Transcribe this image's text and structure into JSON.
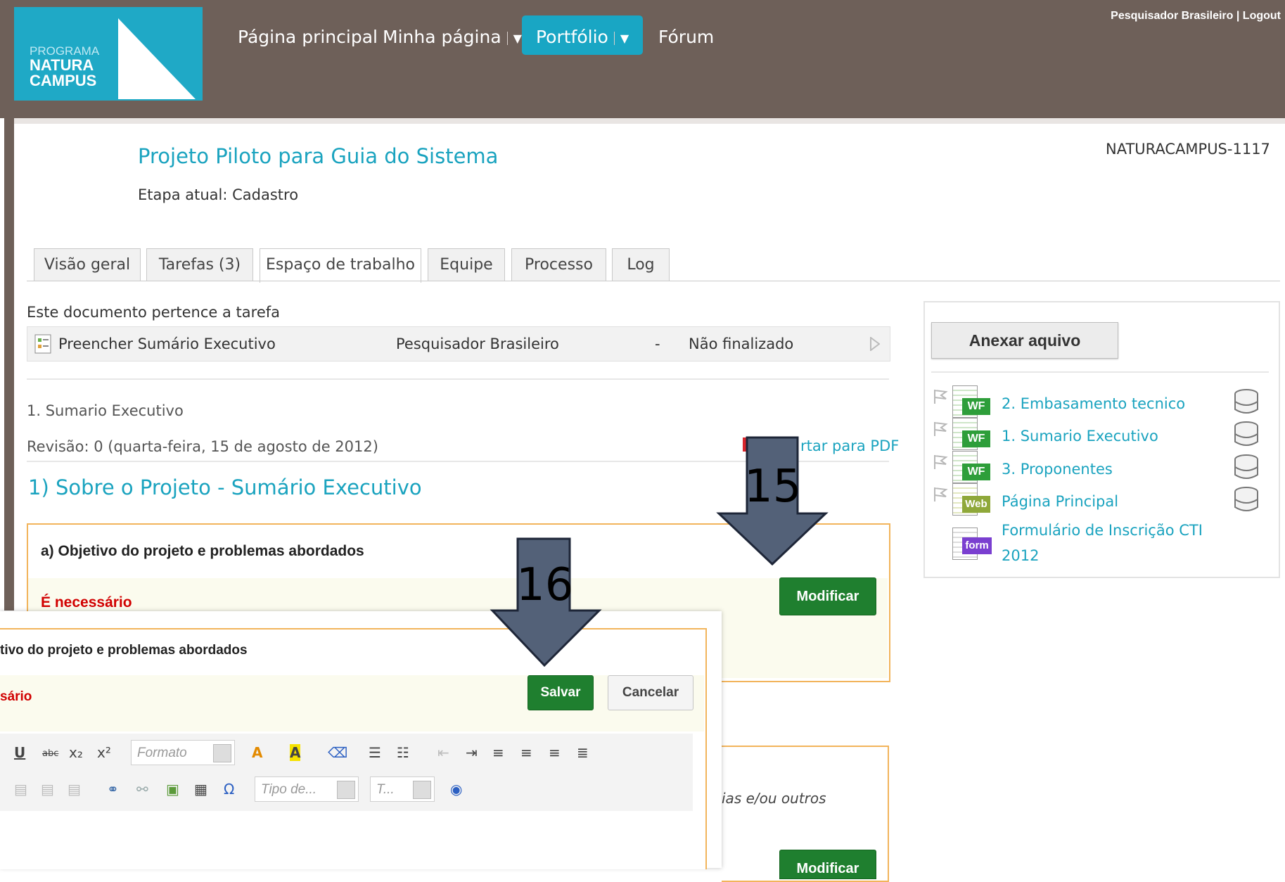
{
  "header": {
    "logo": {
      "line1": "PROGRAMA",
      "line2": "NATURA",
      "line3": "CAMPUS"
    },
    "nav": [
      {
        "label": "Página principal"
      },
      {
        "label": "Minha página"
      },
      {
        "label": "Portfólio"
      },
      {
        "label": "Fórum"
      }
    ],
    "user_links": "Pesquisador Brasileiro | Logout"
  },
  "project": {
    "title": "Projeto Piloto para Guia do Sistema",
    "stage": "Etapa atual: Cadastro",
    "id": "NATURACAMPUS-1117"
  },
  "tabs": [
    {
      "label": "Visão geral"
    },
    {
      "label": "Tarefas (3)"
    },
    {
      "label": "Espaço de trabalho",
      "active": true
    },
    {
      "label": "Equipe"
    },
    {
      "label": "Processo"
    },
    {
      "label": "Log"
    }
  ],
  "task": {
    "heading": "Este documento pertence a tarefa",
    "name": "Preencher Sumário Executivo",
    "owner": "Pesquisador Brasileiro",
    "dash": "-",
    "status": "Não finalizado"
  },
  "document": {
    "name": "1. Sumario Executivo",
    "revision": "Revisão: 0 (quarta-feira, 15 de agosto de 2012)",
    "export": "rtar para PDF",
    "section_title": "1) Sobre o Projeto - Sumário Executivo"
  },
  "section_a": {
    "title": "a) Objetivo do projeto e problemas abordados",
    "required": "É necessário",
    "modify": "Modificar"
  },
  "section_b": {
    "fragment": "ias e/ou outros",
    "modify": "Modificar"
  },
  "editor": {
    "title": "tivo do projeto e problemas abordados",
    "required": "sário",
    "save": "Salvar",
    "cancel": "Cancelar",
    "format_placeholder": "Formato",
    "type_placeholder": "Tipo de...",
    "t_placeholder": "T..."
  },
  "sidebar": {
    "attach": "Anexar aquivo",
    "docs": [
      {
        "badge": "WF",
        "label": "2. Embasamento tecnico"
      },
      {
        "badge": "WF",
        "label": "1. Sumario Executivo"
      },
      {
        "badge": "WF",
        "label": "3. Proponentes"
      },
      {
        "badge": "Web",
        "label": "Página Principal"
      },
      {
        "badge": "form",
        "label": "Formulário de Inscrição CTI",
        "label2": "2012"
      }
    ]
  },
  "callouts": {
    "c15": "15",
    "c16": "16"
  },
  "colors": {
    "header": "#6e6059",
    "accent": "#1aa3bf",
    "green": "#1f7f2f",
    "required": "#d10000",
    "frame": "#f2b45b"
  }
}
